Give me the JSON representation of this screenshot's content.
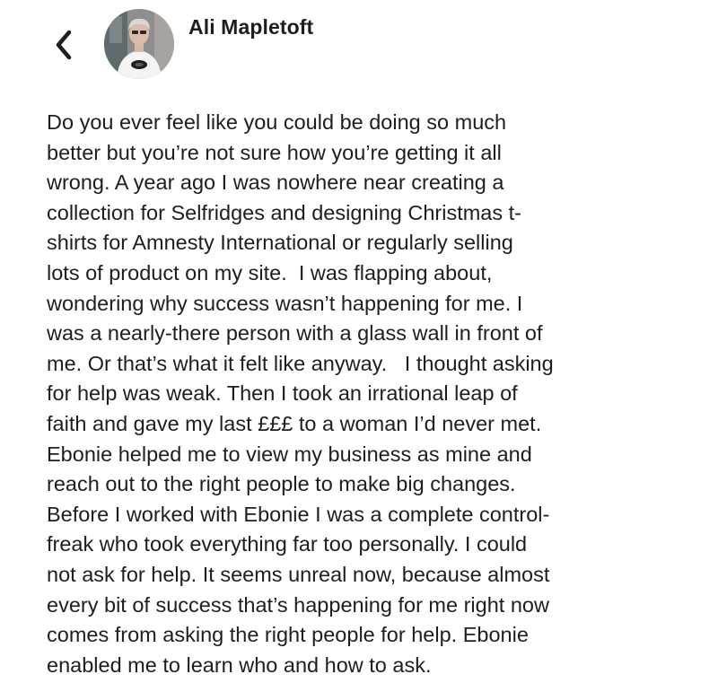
{
  "header": {
    "back_icon": "chevron-left-icon",
    "author_name": "Ali Mapletoft",
    "avatar": "avatar-photo"
  },
  "post": {
    "lines": [
      "Do you ever feel like you could be doing so much",
      "better but you’re not sure how you’re getting it all",
      "wrong. A year ago I was nowhere near creating a",
      "collection for Selfridges and designing Christmas t-",
      "shirts for Amnesty International or regularly selling",
      "lots of product on my site.  I was flapping about,",
      "wondering why success wasn’t happening for me. I",
      "was a nearly-there person with a glass wall in front of",
      "me. Or that’s what it felt like anyway.   I thought asking",
      "for help was weak. Then I took an irrational leap of",
      "faith and gave my last £££ to a woman I’d never met.",
      "Ebonie helped me to view my business as mine and",
      "reach out to the right people to make big changes.",
      "Before I worked with Ebonie I was a complete control-",
      "freak who took everything far too personally. I could",
      "not ask for help. It seems unreal now, because almost",
      "every bit of success that’s happening for me right now",
      "comes from asking the right people for help. Ebonie",
      "enabled me to learn who and how to ask."
    ]
  },
  "colors": {
    "text": "#1c1e21",
    "background": "#ffffff"
  }
}
